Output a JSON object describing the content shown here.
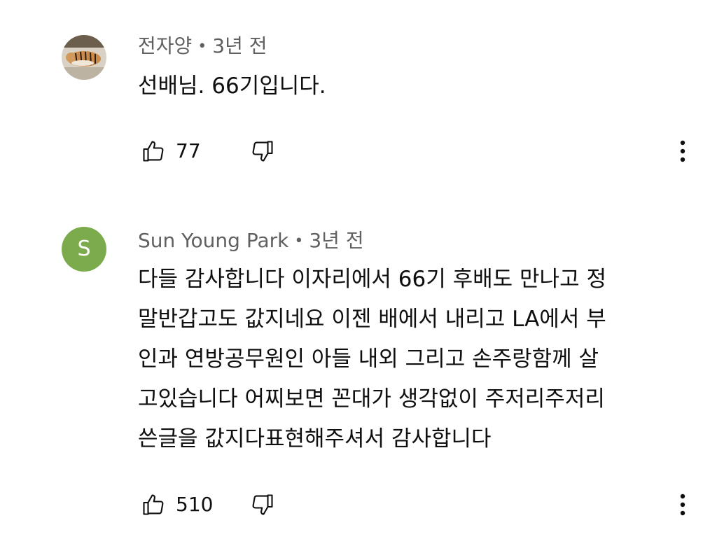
{
  "comments": [
    {
      "author": "전자양",
      "separator": "•",
      "time": "3년 전",
      "avatar_letter": "",
      "lines": [
        "선배님. 66기입니다."
      ],
      "likes": "77"
    },
    {
      "author": "Sun Young Park",
      "separator": "•",
      "time": "3년 전",
      "avatar_letter": "S",
      "lines": [
        "다들 감사합니다  이자리에서 66기 후배도 만나고 정",
        "말반갑고도 값지네요 이젠 배에서 내리고 LA에서 부",
        "인과 연방공무원인 아들 내외 그리고 손주랑함께 살",
        "고있습니다 어찌보면 꼰대가 생각없이 주저리주저리",
        "쓴글을 값지다표현해주셔서 감사합니다"
      ],
      "likes": "510"
    }
  ],
  "icons": {
    "like": "thumbs-up-icon",
    "dislike": "thumbs-down-icon",
    "more": "more-vert-icon"
  },
  "colors": {
    "text": "#0f0f0f",
    "meta": "#606060",
    "avatar_bg": "#7cab4d"
  }
}
